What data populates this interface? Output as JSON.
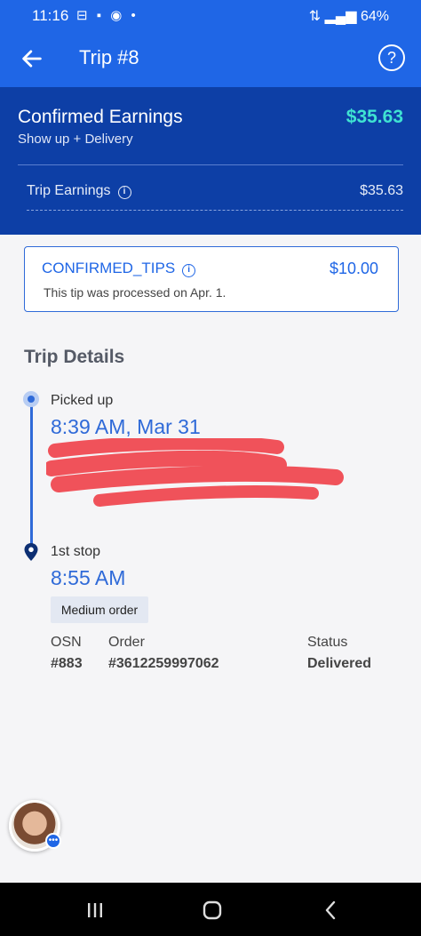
{
  "status_bar": {
    "time": "11:16",
    "notifications": "⊟ ▪ ◉ •",
    "right": "⇅ ▂▄▆ 64%"
  },
  "header": {
    "title": "Trip #8",
    "back_icon": "arrow-left-icon",
    "help_icon": "question-circle-icon"
  },
  "earnings": {
    "label": "Confirmed Earnings",
    "subtitle": "Show up + Delivery",
    "total": "$35.63",
    "trip_label": "Trip Earnings",
    "trip_value": "$35.63"
  },
  "tips": {
    "name": "CONFIRMED_TIPS",
    "amount": "$10.00",
    "note": "This tip was processed on Apr. 1."
  },
  "trip_details": {
    "title": "Trip Details",
    "pickup": {
      "label": "Picked up",
      "time": "8:39 AM, Mar 31"
    },
    "stop": {
      "label": "1st stop",
      "time": "8:55 AM",
      "order_size": "Medium order",
      "columns": [
        "OSN",
        "Order",
        "Status"
      ],
      "values": [
        "#883",
        "#3612259997062",
        "Delivered"
      ]
    }
  },
  "colors": {
    "primary": "#1f66e6",
    "earnings_bg": "#0d3fa6",
    "total_accent": "#3fe3d2",
    "redaction": "#f0525a"
  }
}
